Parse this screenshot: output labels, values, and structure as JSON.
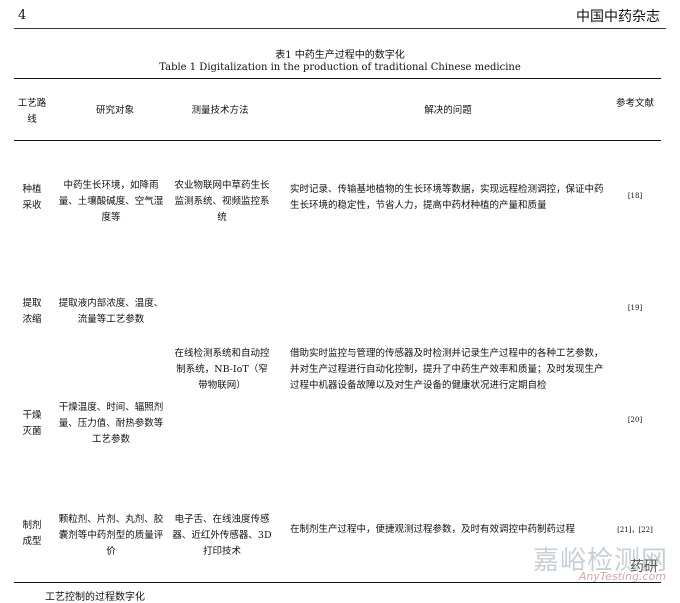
{
  "header": {
    "page_number": "4",
    "journal": "中国中药杂志"
  },
  "caption": {
    "cn": "表1 中药生产过程中的数字化",
    "en": "Table 1 Digitalization in the production of traditional Chinese medicine"
  },
  "table": {
    "headers": [
      "工艺路线",
      "研究对象",
      "测量技术方法",
      "解决的问题",
      "参考文献"
    ],
    "rows": [
      {
        "route": "种植采收",
        "object": "中药生长环境，如降雨量、土壤酸碱度、空气湿度等",
        "method": "农业物联网中草药生长监测系统、视频监控系统",
        "problem": "实时记录、传输基地植物的生长环境等数据，实现远程检测调控，保证中药生长环境的稳定性，节省人力，提高中药材种植的产量和质量",
        "ref": "[18]"
      },
      {
        "route": "提取浓缩",
        "object": "提取液内部浓度、温度、流量等工艺参数",
        "ref": "[19]"
      },
      {
        "shared_method": "在线检测系统和自动控制系统，NB-IoT（窄带物联网）",
        "shared_problem": "借助实时监控与管理的传感器及时检测并记录生产过程中的各种工艺参数，并对生产过程进行自动化控制，提升了中药生产效率和质量；及时发现生产过程中机器设备故障以及对生产设备的健康状况进行定期自检"
      },
      {
        "route": "干燥灭菌",
        "object": "干燥温度、时间、辐照剂量、压力值、耐热参数等工艺参数",
        "ref": "[20]"
      },
      {
        "route": "制剂成型",
        "object": "颗粒剂、片剂、丸剂、胶囊剂等中药剂型的质量评价",
        "method": "电子舌、在线浊度传感器、近红外传感器、3D 打印技术",
        "problem": "在制剂生产过程中，便捷观测过程参数，及时有效调控中药制药过程",
        "ref": "[21]，[22]"
      }
    ]
  },
  "watermark": {
    "cn": "嘉峪检测网",
    "en": "AnyTesting.com",
    "secondary": "药研"
  },
  "bottom_fragment": "工艺控制的过程数字化"
}
